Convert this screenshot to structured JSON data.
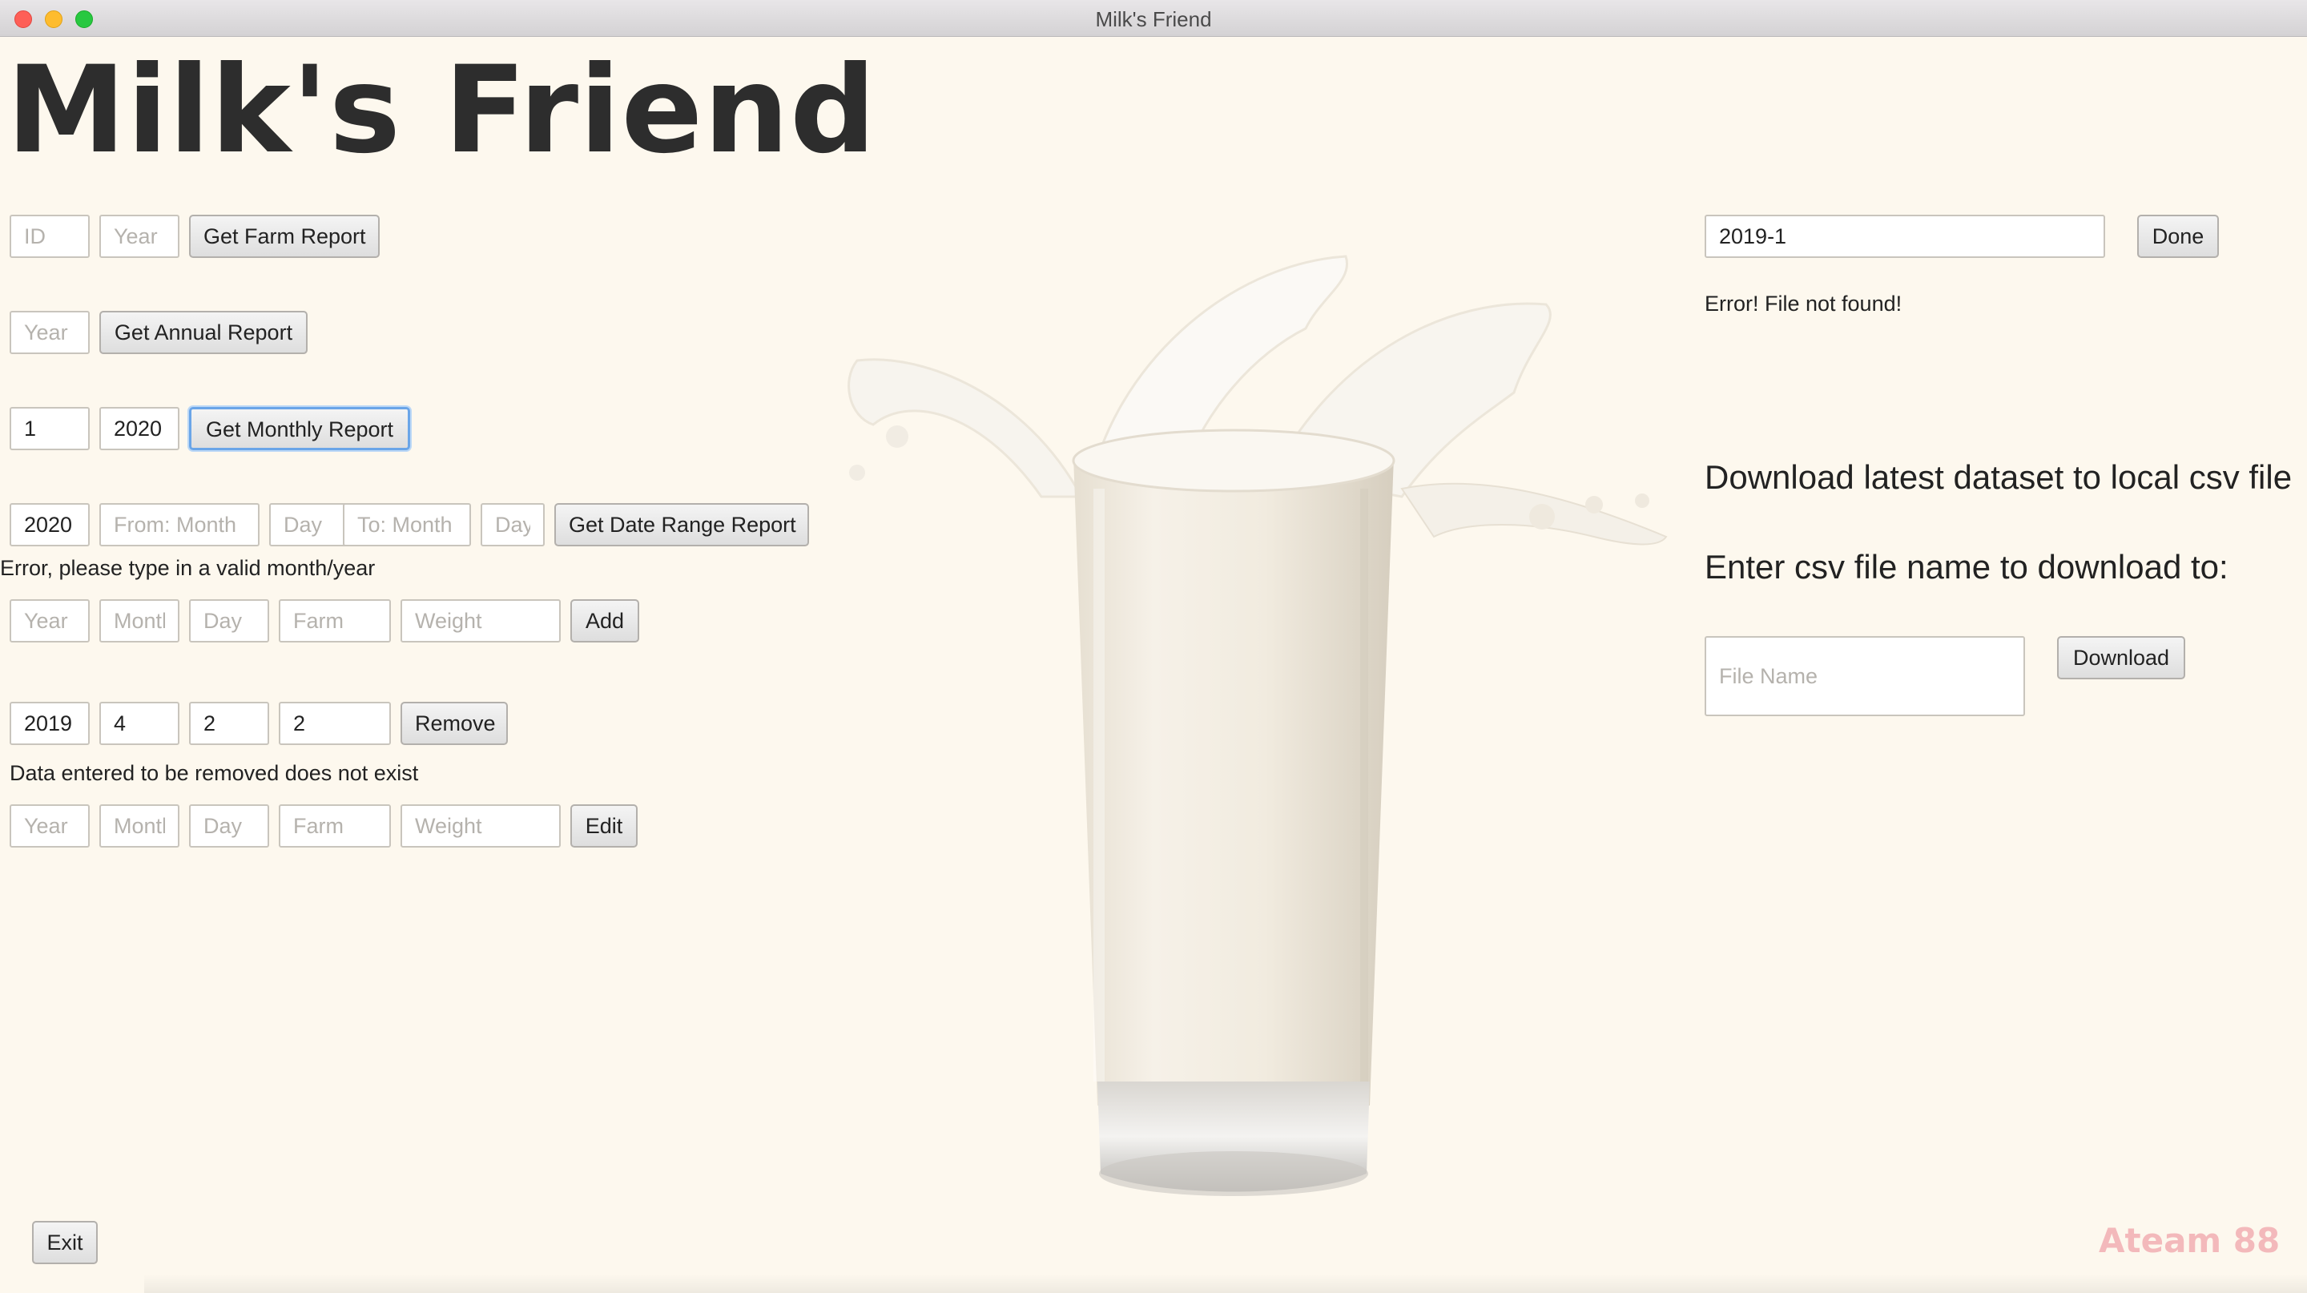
{
  "window": {
    "title": "Milk's Friend"
  },
  "app": {
    "title": "Milk's Friend",
    "brand": "Ateam 88"
  },
  "farm_report": {
    "id_placeholder": "ID",
    "id_value": "",
    "year_placeholder": "Year",
    "year_value": "",
    "button_label": "Get Farm Report"
  },
  "annual_report": {
    "year_placeholder": "Year",
    "year_value": "",
    "button_label": "Get Annual Report"
  },
  "monthly_report": {
    "month_value": "1",
    "year_value": "2020",
    "button_label": "Get Monthly Report"
  },
  "date_range_report": {
    "year_value": "2020",
    "from_month_placeholder": "From: Month",
    "from_day_placeholder": "Day",
    "to_month_placeholder": "To: Month",
    "to_day_placeholder": "Day",
    "button_label": "Get Date Range Report",
    "error_text": "Error, please type in a valid month/year"
  },
  "add_row": {
    "year_placeholder": "Year",
    "month_placeholder": "Month",
    "day_placeholder": "Day",
    "farm_placeholder": "Farm",
    "weight_placeholder": "Weight",
    "button_label": "Add"
  },
  "remove_row": {
    "year_value": "2019",
    "month_value": "4",
    "day_value": "2",
    "farm_value": "2",
    "button_label": "Remove",
    "message": "Data entered to be removed does not exist"
  },
  "edit_row": {
    "year_placeholder": "Year",
    "month_placeholder": "Month",
    "day_placeholder": "Day",
    "farm_placeholder": "Farm",
    "weight_placeholder": "Weight",
    "button_label": "Edit"
  },
  "load_file": {
    "value": "2019-1",
    "button_label": "Done",
    "error_text": "Error! File not found!"
  },
  "download": {
    "heading": "Download latest dataset to local csv file",
    "prompt": "Enter csv file name to download to:",
    "file_placeholder": "File Name",
    "button_label": "Download"
  },
  "exit": {
    "button_label": "Exit"
  },
  "images": {
    "glass": "glass-of-milk-splash"
  },
  "colors": {
    "background": "#fdf8ee",
    "focus_ring": "#6aa5e8",
    "brand": "#f3b9bb"
  }
}
